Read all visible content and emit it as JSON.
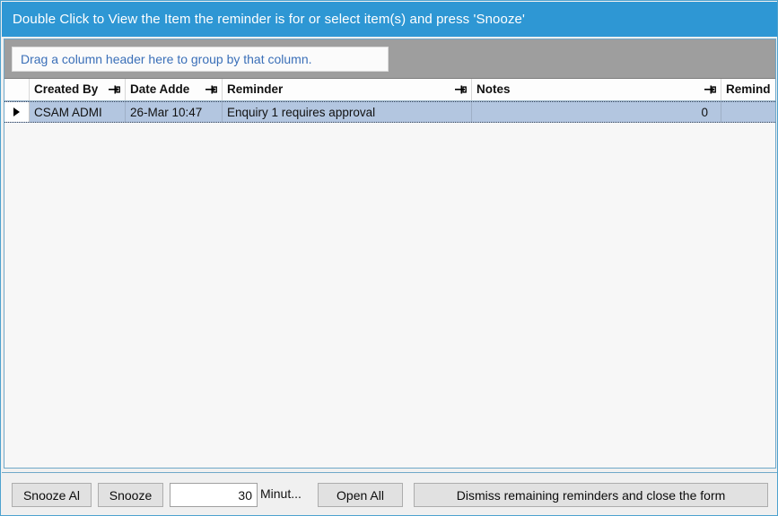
{
  "window": {
    "instruction_bar": "Double Click to View the Item the reminder is for or select item(s) and press 'Snooze'",
    "accent_color": "#2e97d4",
    "selection_color": "#b3c6e0",
    "link_color": "#3a6fb8"
  },
  "grid": {
    "group_panel_hint": "Drag a column header here to group by that column.",
    "columns": [
      {
        "label": "Created By",
        "pin_icon": "pin-icon"
      },
      {
        "label": "Date Adde",
        "pin_icon": "pin-icon"
      },
      {
        "label": "Reminder",
        "pin_icon": "pin-icon"
      },
      {
        "label": "Notes",
        "pin_icon": "pin-icon"
      },
      {
        "label": "Remind",
        "pin_icon": ""
      }
    ],
    "row_indicator_icon": "current-row-arrow-icon",
    "rows": [
      {
        "created_by": "CSAM ADMI",
        "date_added": "26-Mar 10:47",
        "reminder": "Enquiry 1 requires approval",
        "notes": "0",
        "remind": ""
      }
    ]
  },
  "toolbar": {
    "snooze_all_label": "Snooze Al",
    "snooze_label": "Snooze",
    "minutes_value": "30",
    "minutes_placeholder": "",
    "minutes_label": "Minut...",
    "open_all_label": "Open All",
    "dismiss_label": "Dismiss remaining reminders and close the form"
  }
}
